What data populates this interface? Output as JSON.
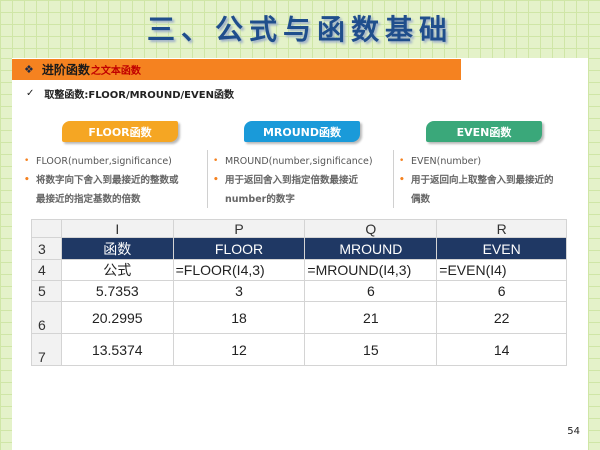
{
  "title": "三、公式与函数基础",
  "section": {
    "bullet": "❖",
    "main": "进阶函数",
    "sub": "之文本函数"
  },
  "subheading": {
    "check": "✓",
    "text": "取整函数:FLOOR/MROUND/EVEN函数"
  },
  "functions": [
    {
      "label": "FLOOR函数",
      "color": "#f5a623",
      "items": [
        "FLOOR(number,significance)",
        "将数字向下舍入到最接近的整数或",
        "最接近的指定基数的倍数"
      ]
    },
    {
      "label": "MROUND函数",
      "color": "#1a9ad9",
      "items": [
        "MROUND(number,significance)",
        "用于返回舍入到指定倍数最接近",
        "number的数字"
      ]
    },
    {
      "label": "EVEN函数",
      "color": "#3aa87a",
      "items": [
        "EVEN(number)",
        "用于返回向上取整舍入到最接近的",
        "偶数"
      ]
    }
  ],
  "sheet": {
    "col_headers": [
      "I",
      "P",
      "Q",
      "R"
    ],
    "rows": [
      {
        "num": "3",
        "cells": [
          "函数",
          "FLOOR",
          "MROUND",
          "EVEN"
        ]
      },
      {
        "num": "4",
        "cells": [
          "公式",
          "=FLOOR(I4,3)",
          "=MROUND(I4,3)",
          "=EVEN(I4)"
        ]
      },
      {
        "num": "5",
        "cells": [
          "5.7353",
          "3",
          "6",
          "6"
        ]
      },
      {
        "num": "6",
        "cells": [
          "20.2995",
          "18",
          "21",
          "22"
        ]
      },
      {
        "num": "7",
        "cells": [
          "13.5374",
          "12",
          "15",
          "14"
        ]
      }
    ]
  },
  "page_number": "54"
}
